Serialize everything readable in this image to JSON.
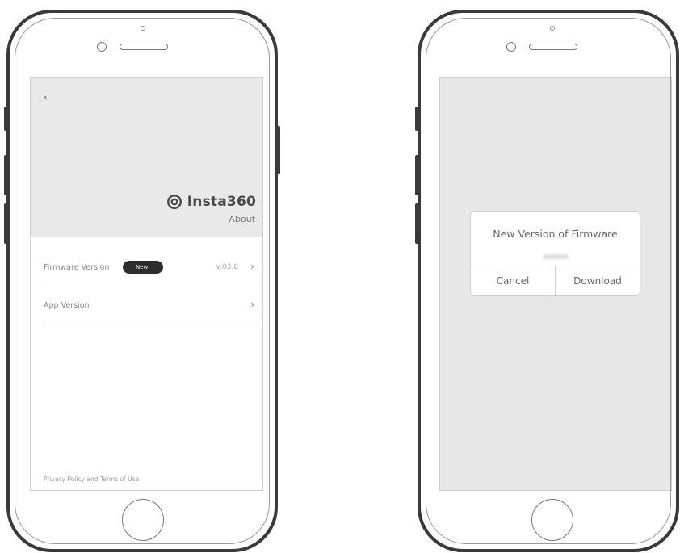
{
  "left_phone": {
    "back_icon": "back-arrow-icon",
    "brand": {
      "logo_icon": "insta360-logo-icon",
      "name": "Insta360"
    },
    "page_title": "About",
    "rows": [
      {
        "label": "Firmware Version",
        "badge": "New!",
        "value": "v.03.0",
        "chevron": "›"
      },
      {
        "label": "App Version",
        "value": "",
        "chevron": "›"
      }
    ],
    "footer_link": "Privacy Policy and Terms of Use"
  },
  "right_phone": {
    "dialog": {
      "title": "New Version of Firmware",
      "cancel_label": "Cancel",
      "download_label": "Download"
    }
  },
  "colors": {
    "header_bg": "#e9e9e9",
    "badge_bg": "#2d2d2d",
    "screen_dim": "#e7e7e7",
    "frame": "#3a3a3a"
  }
}
